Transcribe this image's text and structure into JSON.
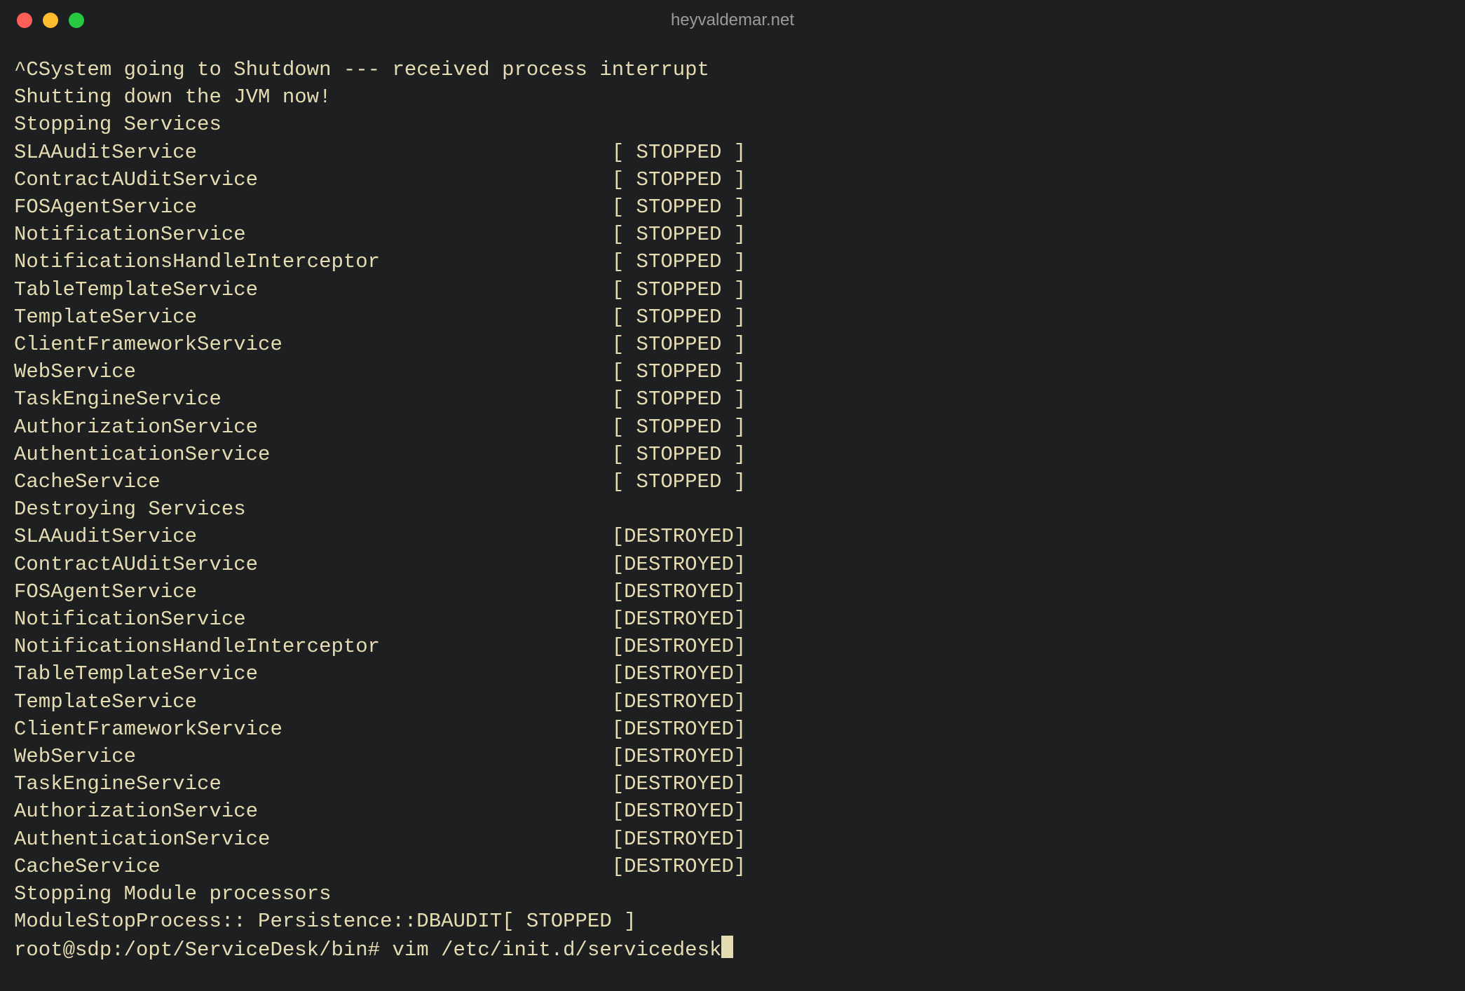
{
  "window": {
    "title": "heyvaldemar.net"
  },
  "colors": {
    "bg": "#1d1f21",
    "fg": "#e6dcb2",
    "title": "#9b9b9b",
    "red": "#ff5f57",
    "yellow": "#febc2e",
    "green": "#28c840"
  },
  "terminal": {
    "prompt": "root@sdp:/opt/ServiceDesk/bin#",
    "command": "vim /etc/init.d/servicedesk",
    "header_lines": [
      "^CSystem going to Shutdown --- received process interrupt",
      "Shutting down the JVM now!",
      "Stopping Services"
    ],
    "stopped_services": [
      "SLAAuditService",
      "ContractAUditService",
      "FOSAgentService",
      "NotificationService",
      "NotificationsHandleInterceptor",
      "TableTemplateService",
      "TemplateService",
      "ClientFrameworkService",
      "WebService",
      "TaskEngineService",
      "AuthorizationService",
      "AuthenticationService",
      "CacheService"
    ],
    "stopped_status": "[ STOPPED ]",
    "destroy_header": "Destroying Services",
    "destroyed_services": [
      "SLAAuditService",
      "ContractAUditService",
      "FOSAgentService",
      "NotificationService",
      "NotificationsHandleInterceptor",
      "TableTemplateService",
      "TemplateService",
      "ClientFrameworkService",
      "WebService",
      "TaskEngineService",
      "AuthorizationService",
      "AuthenticationService",
      "CacheService"
    ],
    "destroyed_status": "[DESTROYED]",
    "footer_lines": [
      "Stopping Module processors",
      ""
    ],
    "module_line_label": "ModuleStopProcess:: Persistence::DBAUDIT",
    "module_line_status": "[ STOPPED ]"
  }
}
